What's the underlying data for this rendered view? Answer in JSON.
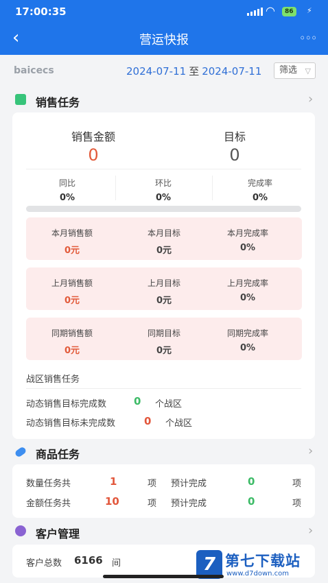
{
  "status_bar": {
    "time": "17:00:35",
    "wifi_icon": "wifi-icon",
    "battery": "86"
  },
  "nav": {
    "back_icon": "chevron-left-icon",
    "title": "营运快报",
    "more_icon": "more-icon"
  },
  "filter": {
    "org": "baicecs",
    "start_date": "2024-07-11",
    "sep": "至",
    "end_date": "2024-07-11",
    "button": "筛选",
    "button_icon": "filter-icon"
  },
  "sales_task": {
    "title": "销售任务",
    "icon": "bag-icon",
    "amount_label": "销售金额",
    "amount_value": "0",
    "target_label": "目标",
    "target_value": "0",
    "rates": [
      {
        "label": "同比",
        "value": "0%"
      },
      {
        "label": "环比",
        "value": "0%"
      },
      {
        "label": "完成率",
        "value": "0%"
      }
    ],
    "progress": 0,
    "panels": [
      [
        {
          "label": "本月销售额",
          "value": "0元"
        },
        {
          "label": "本月目标",
          "value": "0元"
        },
        {
          "label": "本月完成率",
          "value": "0%"
        }
      ],
      [
        {
          "label": "上月销售额",
          "value": "0元"
        },
        {
          "label": "上月目标",
          "value": "0元"
        },
        {
          "label": "上月完成率",
          "value": "0%"
        }
      ],
      [
        {
          "label": "同期销售额",
          "value": "0元"
        },
        {
          "label": "同期目标",
          "value": "0元"
        },
        {
          "label": "同期完成率",
          "value": "0%"
        }
      ]
    ],
    "zone_title": "战区销售任务",
    "zone_done_label": "动态销售目标完成数",
    "zone_done_value": "0",
    "zone_done_unit": "个战区",
    "zone_undone_label": "动态销售目标未完成数",
    "zone_undone_value": "0",
    "zone_undone_unit": "个战区"
  },
  "product_task": {
    "title": "商品任务",
    "icon": "pill-icon",
    "rows": [
      {
        "label": "数量任务共",
        "count": "1",
        "unit": "项",
        "expect": "预计完成",
        "done": "0",
        "unit2": "项"
      },
      {
        "label": "金额任务共",
        "count": "10",
        "unit": "项",
        "expect": "预计完成",
        "done": "0",
        "unit2": "项"
      }
    ]
  },
  "customer": {
    "title": "客户管理",
    "icon": "user-icon",
    "total_label": "客户总数",
    "total_value": "6166",
    "total_unit": "间"
  },
  "watermark": {
    "text": "第七下载站",
    "url": "www.d7down.com",
    "logo": "7"
  }
}
